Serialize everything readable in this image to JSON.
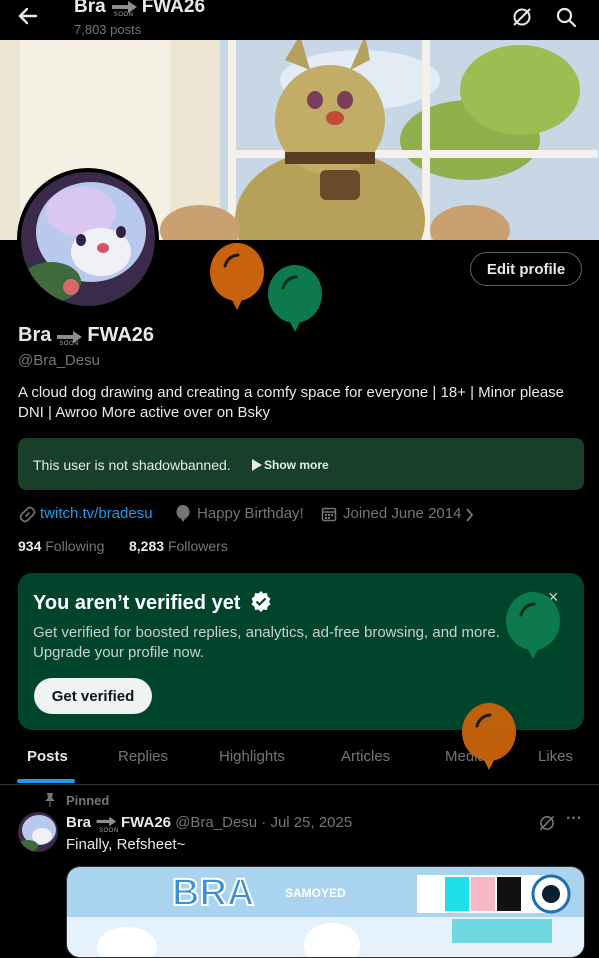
{
  "header": {
    "name_left": "Bra",
    "name_right": "FWA26",
    "soon": "SOON",
    "posts_count": "7,803 posts"
  },
  "profile": {
    "name_left": "Bra",
    "name_right": "FWA26",
    "soon": "SOON",
    "handle": "@Bra_Desu",
    "edit_label": "Edit profile",
    "bio": "A cloud dog drawing and creating a comfy space for everyone | 18+ | Minor please DNI | Awroo More active over on Bsky",
    "shadowban_text": "This user is not shadowbanned.",
    "show_more": "Show more",
    "link": "twitch.tv/bradesu",
    "birthday": "Happy Birthday!",
    "joined": "Joined June 2014",
    "following_count": "934",
    "following_label": "Following",
    "followers_count": "8,283",
    "followers_label": "Followers"
  },
  "verify": {
    "title": "You aren’t verified yet",
    "body": "Get verified for boosted replies, analytics, ad-free browsing, and more. Upgrade your profile now.",
    "button": "Get verified",
    "close": "×"
  },
  "tabs": [
    "Posts",
    "Replies",
    "Highlights",
    "Articles",
    "Media",
    "Likes"
  ],
  "post": {
    "pinned_label": "Pinned",
    "name_left": "Bra",
    "name_right": "FWA26",
    "soon": "SOON",
    "handle_date": "@Bra_Desu · Jul 25, 2025",
    "text": "Finally, Refsheet~",
    "more": "···",
    "media_title": "BRA",
    "media_subtitle": "SAMOYED"
  },
  "colors": {
    "link": "#1d9bf0",
    "verify_bg": "#00452b",
    "shadow_bg": "#173f2a",
    "balloon_orange": "#c9620c",
    "balloon_green": "#0d7a4e"
  }
}
